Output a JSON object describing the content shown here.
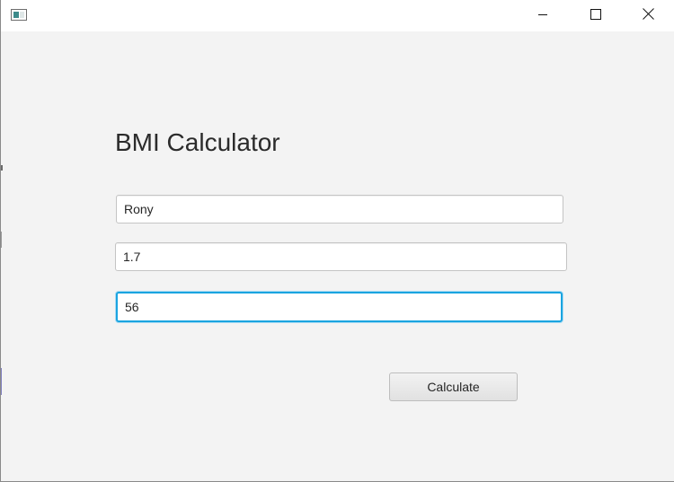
{
  "window": {
    "icon": "app-window-icon",
    "controls": {
      "minimize_icon": "minimize-icon",
      "maximize_icon": "maximize-icon",
      "close_icon": "close-icon"
    }
  },
  "form": {
    "title": "BMI Calculator",
    "name_value": "Rony",
    "height_value": "1.7",
    "weight_value": "56",
    "calculate_label": "Calculate"
  },
  "colors": {
    "background": "#f3f3f3",
    "focus_accent": "#1aa4e0"
  }
}
